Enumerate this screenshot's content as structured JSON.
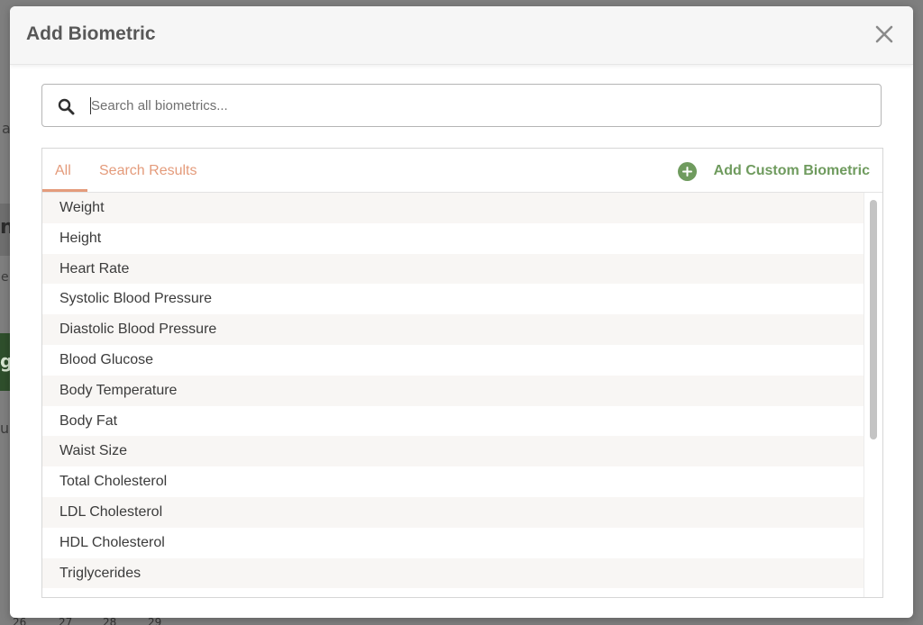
{
  "modal": {
    "title": "Add Biometric"
  },
  "search": {
    "placeholder": "Search all biometrics...",
    "value": ""
  },
  "tabs": [
    {
      "label": "All",
      "active": true
    },
    {
      "label": "Search Results",
      "active": false
    }
  ],
  "add_custom": {
    "label": "Add Custom Biometric"
  },
  "biometrics": [
    "Weight",
    "Height",
    "Heart Rate",
    "Systolic Blood Pressure",
    "Diastolic Blood Pressure",
    "Blood Glucose",
    "Body Temperature",
    "Body Fat",
    "Waist Size",
    "Total Cholesterol",
    "LDL Cholesterol",
    "HDL Cholesterol",
    "Triglycerides"
  ],
  "background": {
    "fragments": [
      "a",
      "n",
      "e",
      "g",
      "ug"
    ],
    "bottom_numbers": [
      "26",
      "27",
      "28",
      "29"
    ]
  },
  "colors": {
    "accent_orange": "#e49b7b",
    "accent_green": "#6f9b5e",
    "header_bg": "#f6f6f6",
    "row_alt_bg": "#f8f6f4",
    "title_text": "#585858"
  },
  "icons": {
    "close": "close-icon",
    "search": "search-icon",
    "add": "plus-circle-icon"
  }
}
